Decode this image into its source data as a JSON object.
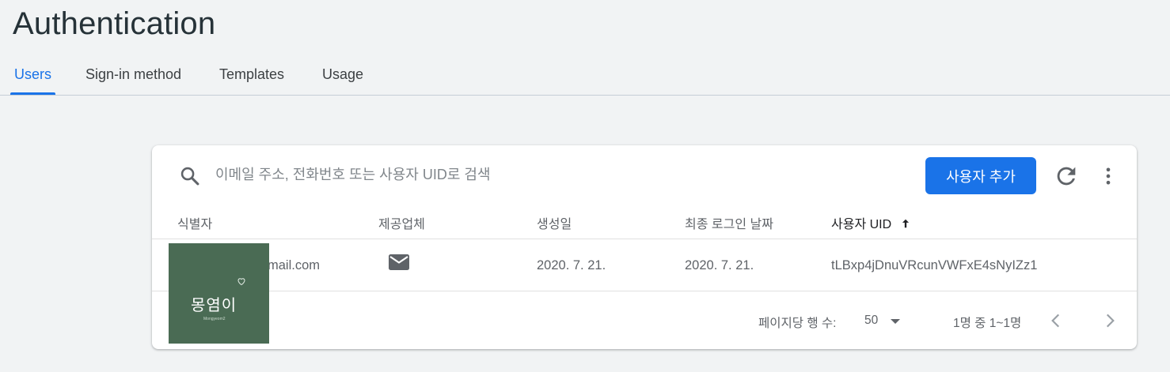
{
  "header": {
    "title": "Authentication"
  },
  "tabs": [
    {
      "label": "Users",
      "active": true
    },
    {
      "label": "Sign-in method",
      "active": false
    },
    {
      "label": "Templates",
      "active": false
    },
    {
      "label": "Usage",
      "active": false
    }
  ],
  "toolbar": {
    "search_placeholder": "이메일 주소, 전화번호 또는 사용자 UID로 검색",
    "search_icon": "search-icon",
    "add_user_label": "사용자 추가",
    "refresh_icon": "refresh-icon",
    "more_icon": "more-vert-icon"
  },
  "table": {
    "columns": [
      "식별자",
      "제공업체",
      "생성일",
      "최종 로그인 날짜",
      "사용자 UID"
    ],
    "sort_icon": "arrow-up-icon",
    "rows": [
      {
        "identifier": "gmail.com",
        "provider_icon": "mail-icon",
        "created": "2020. 7. 21.",
        "last_login": "2020. 7. 21.",
        "uid": "tLBxp4jDnuVRcunVWFxE4sNyIZz1"
      }
    ]
  },
  "pagination": {
    "rows_per_page_label": "페이지당 행 수:",
    "rows_per_page_value": "50",
    "range_label": "1명 중 1~1명"
  },
  "overlay": {
    "avatar_text": "몽염이",
    "avatar_subtext": "Mongyeom2"
  },
  "colors": {
    "accent": "#1a73e8",
    "page_background": "#f1f3f4",
    "card_background": "#ffffff",
    "avatar_background": "#4a6b54"
  }
}
